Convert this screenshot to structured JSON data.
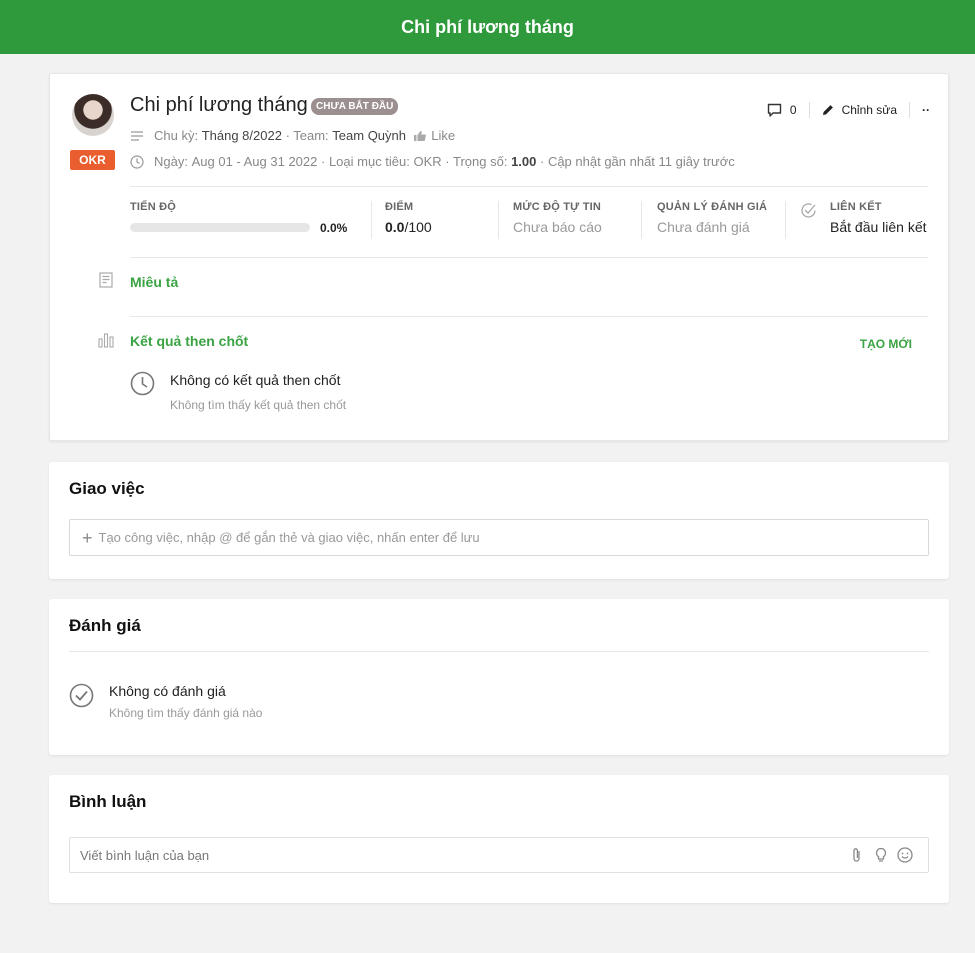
{
  "header": {
    "title": "Chi phí lương tháng"
  },
  "objective": {
    "title": "Chi phí lương tháng",
    "status": "CHƯA BẮT ĐẦU",
    "type_badge": "OKR",
    "cycle_label": "Chu kỳ:",
    "cycle_value": "Tháng 8/2022",
    "team_label": "· Team:",
    "team_value": "Team Quỳnh",
    "like_label": "Like",
    "date_label": "Ngày:",
    "date_value": "Aug 01 - Aug 31 2022",
    "goal_type_label": "· Loại mục tiêu:",
    "goal_type_value": "OKR",
    "weight_label": "· Trọng số:",
    "weight_value": "1.00",
    "updated_text": "· Cập nhật gần nhất 11 giây trước",
    "comment_count": "0",
    "edit_label": "Chỉnh sửa",
    "more_label": "··"
  },
  "stats": {
    "progress_label": "TIẾN ĐỘ",
    "progress_value": "0.0%",
    "progress_fraction": 0,
    "score_label": "ĐIỂM",
    "score_value": "0.0",
    "score_max": "/100",
    "confidence_label": "MỨC ĐỘ TỰ TIN",
    "confidence_value": "Chưa báo cáo",
    "review_label": "QUẢN LÝ ĐÁNH GIÁ",
    "review_value": "Chưa đánh giá",
    "link_label": "LIÊN KẾT",
    "link_value": "Bắt đầu liên kết"
  },
  "description": {
    "heading": "Miêu tả"
  },
  "key_results": {
    "heading": "Kết quả then chốt",
    "create_label": "TẠO MỚI",
    "empty_title": "Không có kết quả then chốt",
    "empty_sub": "Không tìm thấy kết quả then chốt"
  },
  "tasks": {
    "heading": "Giao việc",
    "placeholder": "Tạo công việc, nhập @ để gắn thẻ và giao việc, nhấn enter để lưu"
  },
  "reviews": {
    "heading": "Đánh giá",
    "empty_title": "Không có đánh giá",
    "empty_sub": "Không tìm thấy đánh giá nào"
  },
  "comments": {
    "heading": "Bình luận",
    "placeholder": "Viết bình luận của bạn"
  },
  "colors": {
    "brand": "#2e9a3c",
    "accent_text": "#3aa343",
    "okr_badge": "#e95d2e",
    "status_badge": "#9c8f8f"
  }
}
